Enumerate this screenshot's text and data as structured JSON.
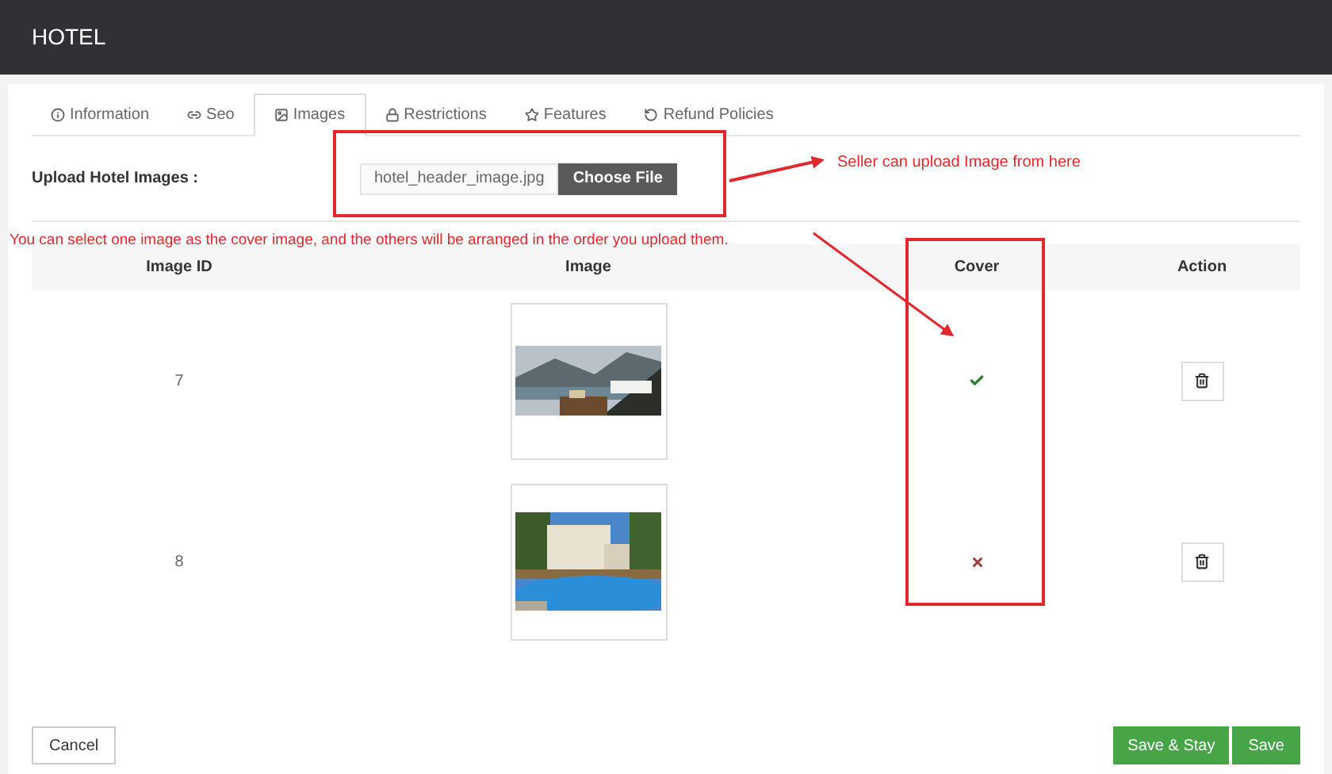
{
  "header": {
    "title": "HOTEL"
  },
  "tabs": [
    {
      "label": "Information",
      "selected": false
    },
    {
      "label": "Seo",
      "selected": false
    },
    {
      "label": "Images",
      "selected": true
    },
    {
      "label": "Restrictions",
      "selected": false
    },
    {
      "label": "Features",
      "selected": false
    },
    {
      "label": "Refund Policies",
      "selected": false
    }
  ],
  "upload": {
    "label": "Upload Hotel Images :",
    "file_name": "hotel_header_image.jpg",
    "button": "Choose File"
  },
  "table": {
    "columns": [
      "Image ID",
      "Image",
      "Cover",
      "Action"
    ],
    "rows": [
      {
        "id": "7",
        "cover": true
      },
      {
        "id": "8",
        "cover": false
      }
    ]
  },
  "footer": {
    "cancel": "Cancel",
    "save_stay": "Save & Stay",
    "save": "Save"
  },
  "annotations": [
    {
      "text": "Seller can upload Image from here"
    },
    {
      "text": "You can select one image as the cover image, and the others will be arranged in the order you upload them."
    }
  ]
}
